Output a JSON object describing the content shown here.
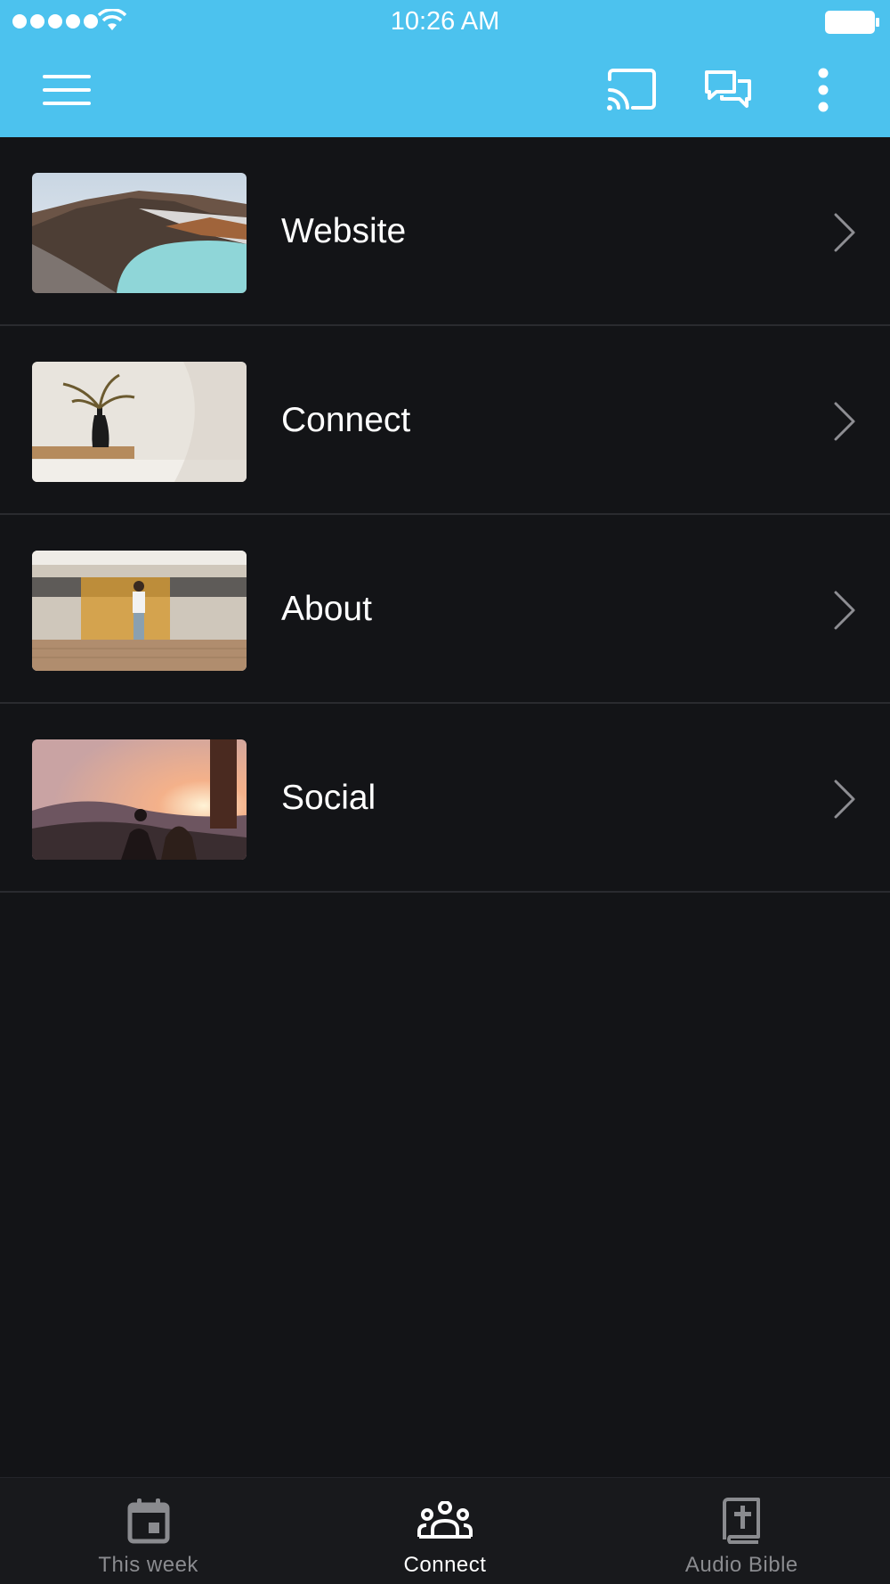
{
  "status_bar": {
    "time": "10:26 AM"
  },
  "app_bar": {
    "icons": [
      "menu-icon",
      "cast-icon",
      "chat-icon",
      "more-vertical-icon"
    ],
    "color": "#4cc2ee"
  },
  "list": {
    "items": [
      {
        "label": "Website",
        "thumbnail": "crater-lake-image"
      },
      {
        "label": "Connect",
        "thumbnail": "vase-plant-image"
      },
      {
        "label": "About",
        "thumbnail": "train-platform-image"
      },
      {
        "label": "Social",
        "thumbnail": "sunset-people-image"
      }
    ]
  },
  "tab_bar": {
    "tabs": [
      {
        "label": "This week",
        "icon": "calendar-icon",
        "active": false
      },
      {
        "label": "Connect",
        "icon": "people-group-icon",
        "active": true
      },
      {
        "label": "Audio Bible",
        "icon": "bible-icon",
        "active": false
      }
    ]
  },
  "colors": {
    "accent": "#4cc2ee",
    "background": "#131417",
    "inactive_tab": "#8a8b8f"
  }
}
